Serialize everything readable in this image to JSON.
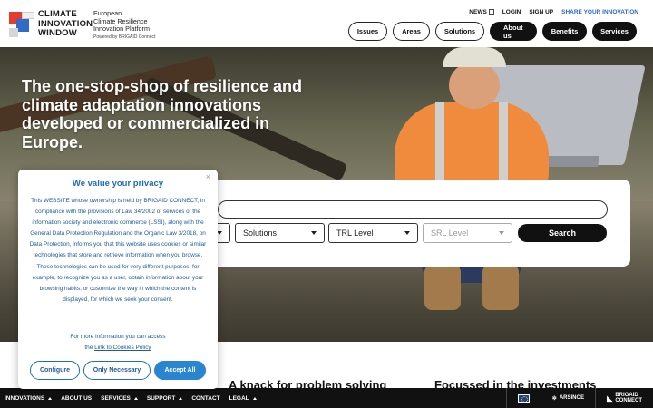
{
  "header": {
    "logo_line1": "CLIMATE",
    "logo_line2": "INNOVATION",
    "logo_line3": "WINDOW",
    "platform_line1": "European",
    "platform_line2": "Climate Resilience",
    "platform_line3": "Innovation Platform",
    "powered_by": "Powered by BRIGAID Connect",
    "top_links": {
      "news": "NEWS",
      "login": "LOGIN",
      "signup": "SIGN UP",
      "share": "SHARE YOUR INNOVATION"
    },
    "nav": {
      "issues": "Issues",
      "areas": "Areas",
      "solutions": "Solutions",
      "about": "About us",
      "benefits": "Benefits",
      "services": "Services"
    }
  },
  "hero": {
    "title": "The one-stop-shop of resilience and climate adaptation innovations developed or commercialized in Europe."
  },
  "search": {
    "input_value": "",
    "solutions_select": "Solutions",
    "trl_select": "TRL Level",
    "srl_select": "SRL Level",
    "button": "Search"
  },
  "sections": {
    "problem_solving": "A knack for problem solving",
    "investments": "Focussed in the investments"
  },
  "cookie": {
    "title": "We value your privacy",
    "body": "This WEBSITE whose ownership is held by BRIGAID CONNECT, in compliance with the provisions of Law 34/2002 of services of the information society and electronic commerce (LSSI), along with the General Data Protection Regulation and the Organic Law 3/2018, on Data Protection, informs you that this website uses cookies or similar technologies that store and retrieve information when you browse. These technologies can be used for very different purposes, for example, to recognize you as a user, obtain information about your browsing habits, or customize the way in which the content is displayed, for which we seek your consent.",
    "more_info": "For more information you can access",
    "more_info_the": "the",
    "link": "Link to Cookies Policy",
    "configure": "Configure",
    "only_necessary": "Only Necessary",
    "accept_all": "Accept All",
    "close": "×"
  },
  "bottom_bar": {
    "innovations": "INNOVATIONS",
    "about": "ABOUT US",
    "services": "SERVICES",
    "support": "SUPPORT",
    "contact": "CONTACT",
    "legal": "LEGAL",
    "arsinoe": "ARSINOE",
    "brigaid_line1": "BRIGAID",
    "brigaid_line2": "CONNECT"
  },
  "colors": {
    "accent_blue": "#2a85d0",
    "cookie_text": "#1e5a9c",
    "share_link": "#2f6bc7",
    "hero_shirt": "#f08a3c"
  }
}
